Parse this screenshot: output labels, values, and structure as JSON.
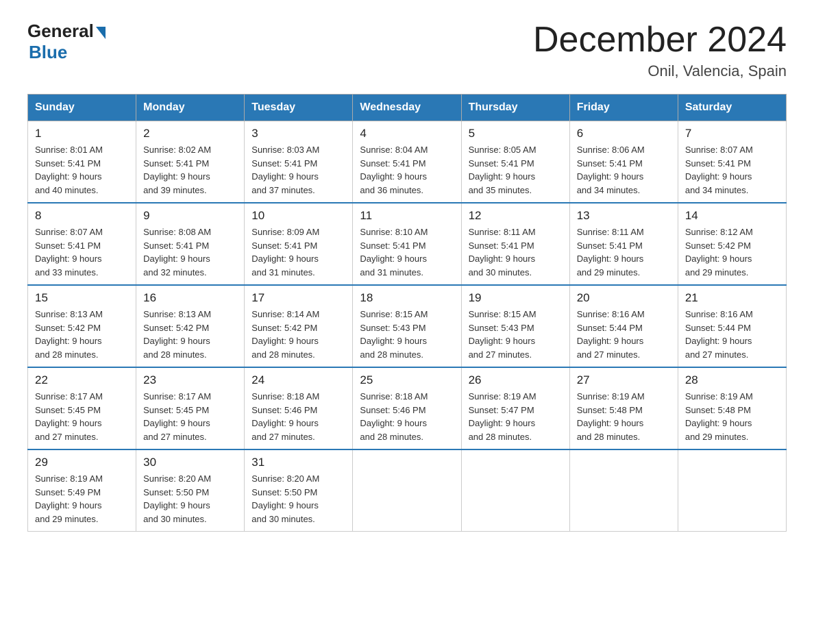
{
  "header": {
    "logo_general": "General",
    "logo_blue": "Blue",
    "title": "December 2024",
    "subtitle": "Onil, Valencia, Spain"
  },
  "days_of_week": [
    "Sunday",
    "Monday",
    "Tuesday",
    "Wednesday",
    "Thursday",
    "Friday",
    "Saturday"
  ],
  "weeks": [
    [
      {
        "day": "1",
        "sunrise": "8:01 AM",
        "sunset": "5:41 PM",
        "daylight": "9 hours and 40 minutes."
      },
      {
        "day": "2",
        "sunrise": "8:02 AM",
        "sunset": "5:41 PM",
        "daylight": "9 hours and 39 minutes."
      },
      {
        "day": "3",
        "sunrise": "8:03 AM",
        "sunset": "5:41 PM",
        "daylight": "9 hours and 37 minutes."
      },
      {
        "day": "4",
        "sunrise": "8:04 AM",
        "sunset": "5:41 PM",
        "daylight": "9 hours and 36 minutes."
      },
      {
        "day": "5",
        "sunrise": "8:05 AM",
        "sunset": "5:41 PM",
        "daylight": "9 hours and 35 minutes."
      },
      {
        "day": "6",
        "sunrise": "8:06 AM",
        "sunset": "5:41 PM",
        "daylight": "9 hours and 34 minutes."
      },
      {
        "day": "7",
        "sunrise": "8:07 AM",
        "sunset": "5:41 PM",
        "daylight": "9 hours and 34 minutes."
      }
    ],
    [
      {
        "day": "8",
        "sunrise": "8:07 AM",
        "sunset": "5:41 PM",
        "daylight": "9 hours and 33 minutes."
      },
      {
        "day": "9",
        "sunrise": "8:08 AM",
        "sunset": "5:41 PM",
        "daylight": "9 hours and 32 minutes."
      },
      {
        "day": "10",
        "sunrise": "8:09 AM",
        "sunset": "5:41 PM",
        "daylight": "9 hours and 31 minutes."
      },
      {
        "day": "11",
        "sunrise": "8:10 AM",
        "sunset": "5:41 PM",
        "daylight": "9 hours and 31 minutes."
      },
      {
        "day": "12",
        "sunrise": "8:11 AM",
        "sunset": "5:41 PM",
        "daylight": "9 hours and 30 minutes."
      },
      {
        "day": "13",
        "sunrise": "8:11 AM",
        "sunset": "5:41 PM",
        "daylight": "9 hours and 29 minutes."
      },
      {
        "day": "14",
        "sunrise": "8:12 AM",
        "sunset": "5:42 PM",
        "daylight": "9 hours and 29 minutes."
      }
    ],
    [
      {
        "day": "15",
        "sunrise": "8:13 AM",
        "sunset": "5:42 PM",
        "daylight": "9 hours and 28 minutes."
      },
      {
        "day": "16",
        "sunrise": "8:13 AM",
        "sunset": "5:42 PM",
        "daylight": "9 hours and 28 minutes."
      },
      {
        "day": "17",
        "sunrise": "8:14 AM",
        "sunset": "5:42 PM",
        "daylight": "9 hours and 28 minutes."
      },
      {
        "day": "18",
        "sunrise": "8:15 AM",
        "sunset": "5:43 PM",
        "daylight": "9 hours and 28 minutes."
      },
      {
        "day": "19",
        "sunrise": "8:15 AM",
        "sunset": "5:43 PM",
        "daylight": "9 hours and 27 minutes."
      },
      {
        "day": "20",
        "sunrise": "8:16 AM",
        "sunset": "5:44 PM",
        "daylight": "9 hours and 27 minutes."
      },
      {
        "day": "21",
        "sunrise": "8:16 AM",
        "sunset": "5:44 PM",
        "daylight": "9 hours and 27 minutes."
      }
    ],
    [
      {
        "day": "22",
        "sunrise": "8:17 AM",
        "sunset": "5:45 PM",
        "daylight": "9 hours and 27 minutes."
      },
      {
        "day": "23",
        "sunrise": "8:17 AM",
        "sunset": "5:45 PM",
        "daylight": "9 hours and 27 minutes."
      },
      {
        "day": "24",
        "sunrise": "8:18 AM",
        "sunset": "5:46 PM",
        "daylight": "9 hours and 27 minutes."
      },
      {
        "day": "25",
        "sunrise": "8:18 AM",
        "sunset": "5:46 PM",
        "daylight": "9 hours and 28 minutes."
      },
      {
        "day": "26",
        "sunrise": "8:19 AM",
        "sunset": "5:47 PM",
        "daylight": "9 hours and 28 minutes."
      },
      {
        "day": "27",
        "sunrise": "8:19 AM",
        "sunset": "5:48 PM",
        "daylight": "9 hours and 28 minutes."
      },
      {
        "day": "28",
        "sunrise": "8:19 AM",
        "sunset": "5:48 PM",
        "daylight": "9 hours and 29 minutes."
      }
    ],
    [
      {
        "day": "29",
        "sunrise": "8:19 AM",
        "sunset": "5:49 PM",
        "daylight": "9 hours and 29 minutes."
      },
      {
        "day": "30",
        "sunrise": "8:20 AM",
        "sunset": "5:50 PM",
        "daylight": "9 hours and 30 minutes."
      },
      {
        "day": "31",
        "sunrise": "8:20 AM",
        "sunset": "5:50 PM",
        "daylight": "9 hours and 30 minutes."
      },
      null,
      null,
      null,
      null
    ]
  ],
  "labels": {
    "sunrise": "Sunrise:",
    "sunset": "Sunset:",
    "daylight": "Daylight:"
  }
}
